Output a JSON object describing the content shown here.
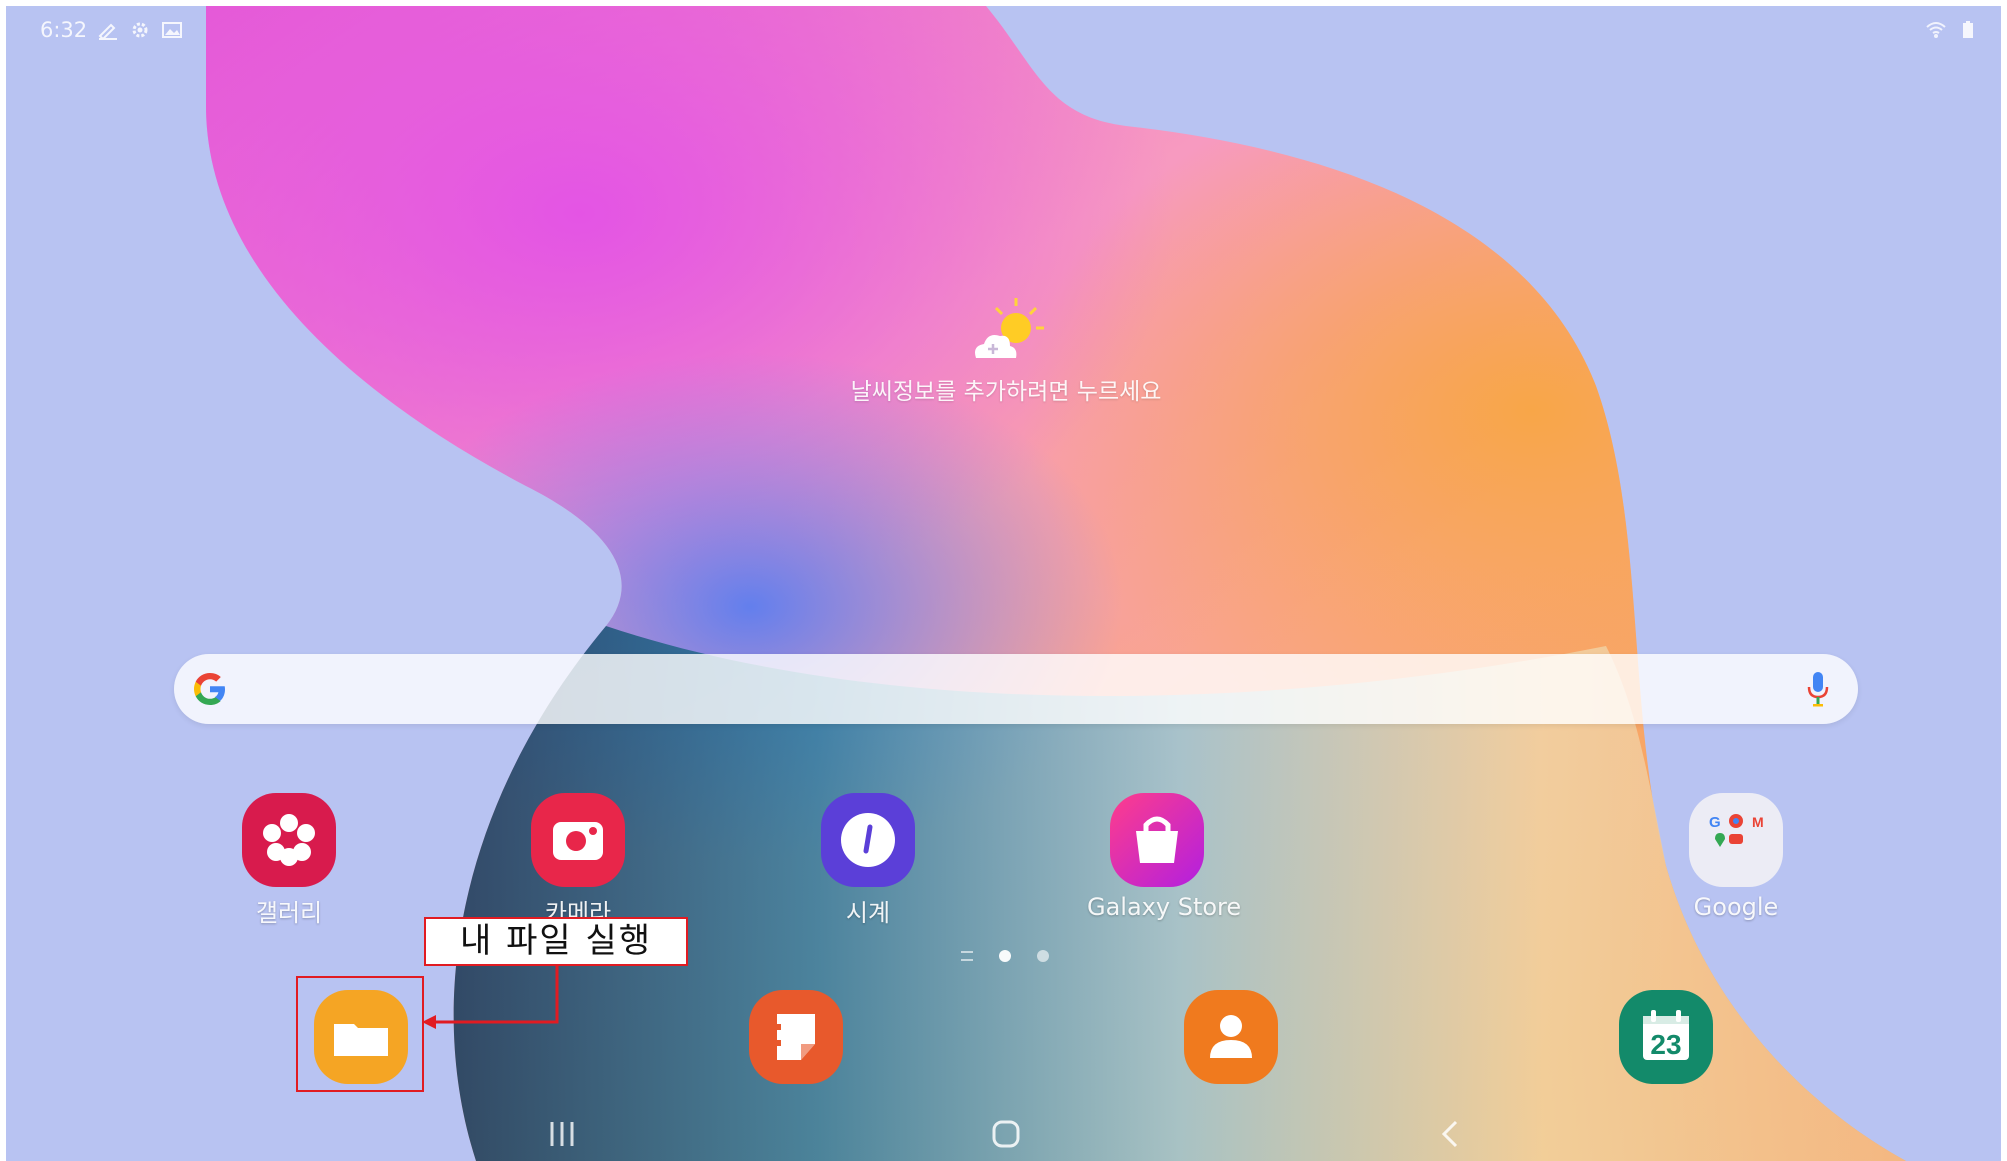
{
  "status_bar": {
    "time": "6:32"
  },
  "weather": {
    "prompt": "날씨정보를 추가하려면 누르세요"
  },
  "apps": [
    {
      "label": "갤러리",
      "icon": "gallery-icon",
      "color": "#d81b4d"
    },
    {
      "label": "카메라",
      "icon": "camera-icon",
      "color": "#e8264a"
    },
    {
      "label": "시계",
      "icon": "clock-icon",
      "color": "#5b3fd8"
    },
    {
      "label": "Galaxy Store",
      "icon": "galaxy-store-icon",
      "color": "#d21fb0"
    },
    {
      "label": "Google",
      "icon": "google-folder-icon",
      "color": "#e9e9ee"
    }
  ],
  "dock": [
    {
      "icon": "my-files-icon",
      "color": "#f5a524"
    },
    {
      "icon": "samsung-notes-icon",
      "color": "#e8592c"
    },
    {
      "icon": "contacts-icon",
      "color": "#f07a1e"
    },
    {
      "icon": "calendar-icon",
      "color": "#138a6a",
      "day": "23"
    }
  ],
  "annotation": {
    "label": "내 파일 실행",
    "color": "#e11b22"
  }
}
